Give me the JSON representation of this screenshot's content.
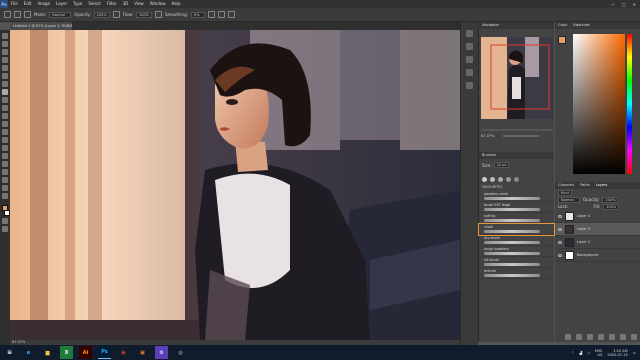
{
  "menubar": {
    "logo": "Ps",
    "items": [
      "File",
      "Edit",
      "Image",
      "Layer",
      "Type",
      "Select",
      "Filter",
      "3D",
      "View",
      "Window",
      "Help"
    ],
    "controls": [
      "—",
      "□",
      "✕"
    ]
  },
  "options": {
    "mode_label": "Mode:",
    "mode_value": "Normal",
    "opacity_label": "Opacity:",
    "opacity_value": "100%",
    "flow_label": "Flow:",
    "flow_value": "100%",
    "smoothing_label": "Smoothing:",
    "smoothing_value": "0%"
  },
  "document": {
    "tab_title": "Untitled-1 @ 67% (Layer 3, RGB/8)",
    "status": "67.07%"
  },
  "navigator": {
    "tab": "Navigator",
    "zoom": "67.07%"
  },
  "color": {
    "tab1": "Color",
    "tab2": "Swatches",
    "hue_color": "#ff6a00"
  },
  "brushes": {
    "tab": "Brushes",
    "size_label": "Size:",
    "size_value": "25 px",
    "group": "FAVOURITES",
    "items": [
      {
        "name": "powdery small",
        "selected": false
      },
      {
        "name": "brush EXT large",
        "selected": false
      },
      {
        "name": "soft tip",
        "selected": false
      },
      {
        "name": "chalk",
        "selected": true
      },
      {
        "name": "dry brush",
        "selected": false
      },
      {
        "name": "rough powdery",
        "selected": false
      },
      {
        "name": "ink brush",
        "selected": false
      },
      {
        "name": "texture",
        "selected": false
      }
    ]
  },
  "layers": {
    "tabs": [
      "Channels",
      "Paths",
      "Layers"
    ],
    "kind_label": "Kind",
    "blend": "Normal",
    "opacity_label": "Opacity:",
    "opacity_value": "100%",
    "lock_label": "Lock:",
    "fill_label": "Fill:",
    "fill_value": "100%",
    "rows": [
      {
        "name": "Layer 4",
        "selected": false
      },
      {
        "name": "Layer 3",
        "selected": true
      },
      {
        "name": "Layer 2",
        "selected": false
      },
      {
        "name": "Background",
        "selected": false
      }
    ]
  },
  "taskbar": {
    "apps": [
      {
        "name": "start",
        "label": "⊞",
        "color": "#ffffff",
        "bg": "transparent"
      },
      {
        "name": "edge",
        "label": "e",
        "color": "#3da8f5",
        "bg": "transparent"
      },
      {
        "name": "explorer",
        "label": "▆",
        "color": "#f5c542",
        "bg": "transparent"
      },
      {
        "name": "excel",
        "label": "X",
        "color": "#ffffff",
        "bg": "#1f7a3e"
      },
      {
        "name": "illustrator",
        "label": "Ai",
        "color": "#ff9a00",
        "bg": "#330000"
      },
      {
        "name": "photoshop",
        "label": "Ps",
        "color": "#31a8ff",
        "bg": "#001e36"
      },
      {
        "name": "chrome",
        "label": "◉",
        "color": "#e94235",
        "bg": "transparent"
      },
      {
        "name": "app-orange",
        "label": "▣",
        "color": "#f08a24",
        "bg": "transparent"
      },
      {
        "name": "settings",
        "label": "⚙",
        "color": "#ffffff",
        "bg": "#5b3fb8"
      },
      {
        "name": "obs",
        "label": "◎",
        "color": "#dddddd",
        "bg": "transparent"
      }
    ],
    "lang": "ENG",
    "lang2": "US",
    "time": "1:10 AM",
    "date": "2020-07-15"
  }
}
